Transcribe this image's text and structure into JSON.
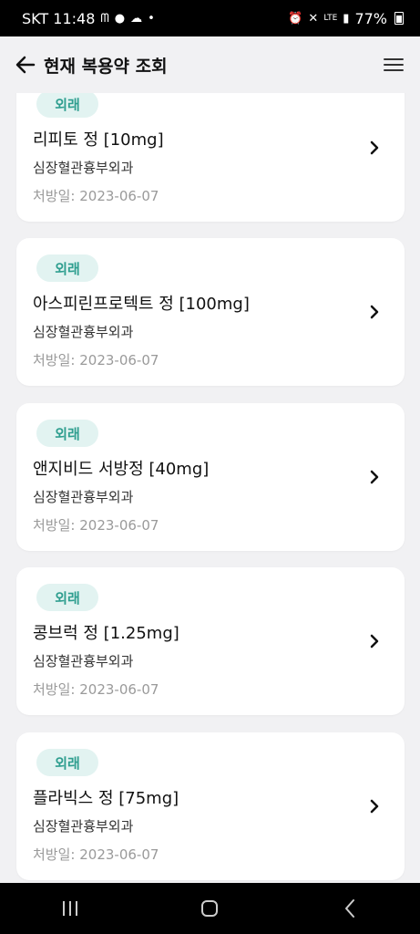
{
  "status_bar": {
    "carrier_time": "SKT 11:48",
    "battery": "77%",
    "icons": [
      "n-icon",
      "talk-icon",
      "cloud-icon",
      "dot-icon",
      "alarm-icon",
      "mute-icon",
      "lte-icon",
      "signal-icon"
    ]
  },
  "header": {
    "title": "현재 복용약 조회",
    "back_icon": "arrow-left-icon",
    "menu_icon": "hamburger-icon"
  },
  "date_label": "처방일: ",
  "medications": [
    {
      "badge": "외래",
      "name": "리피토 정 [10mg]",
      "department": "심장혈관흉부외과",
      "date": "2023-06-07"
    },
    {
      "badge": "외래",
      "name": "아스피린프로텍트 정 [100mg]",
      "department": "심장혈관흉부외과",
      "date": "2023-06-07"
    },
    {
      "badge": "외래",
      "name": "앤지비드 서방정 [40mg]",
      "department": "심장혈관흉부외과",
      "date": "2023-06-07"
    },
    {
      "badge": "외래",
      "name": "콩브럭 정 [1.25mg]",
      "department": "심장혈관흉부외과",
      "date": "2023-06-07"
    },
    {
      "badge": "외래",
      "name": "플라빅스 정 [75mg]",
      "department": "심장혈관흉부외과",
      "date": "2023-06-07"
    }
  ],
  "nav": {
    "recent_icon": "recent-apps-icon",
    "home_icon": "home-icon",
    "back_icon": "back-icon"
  },
  "colors": {
    "badge_bg": "#e2f3f1",
    "badge_text": "#2e9e8f",
    "background": "#f1f1f3"
  }
}
